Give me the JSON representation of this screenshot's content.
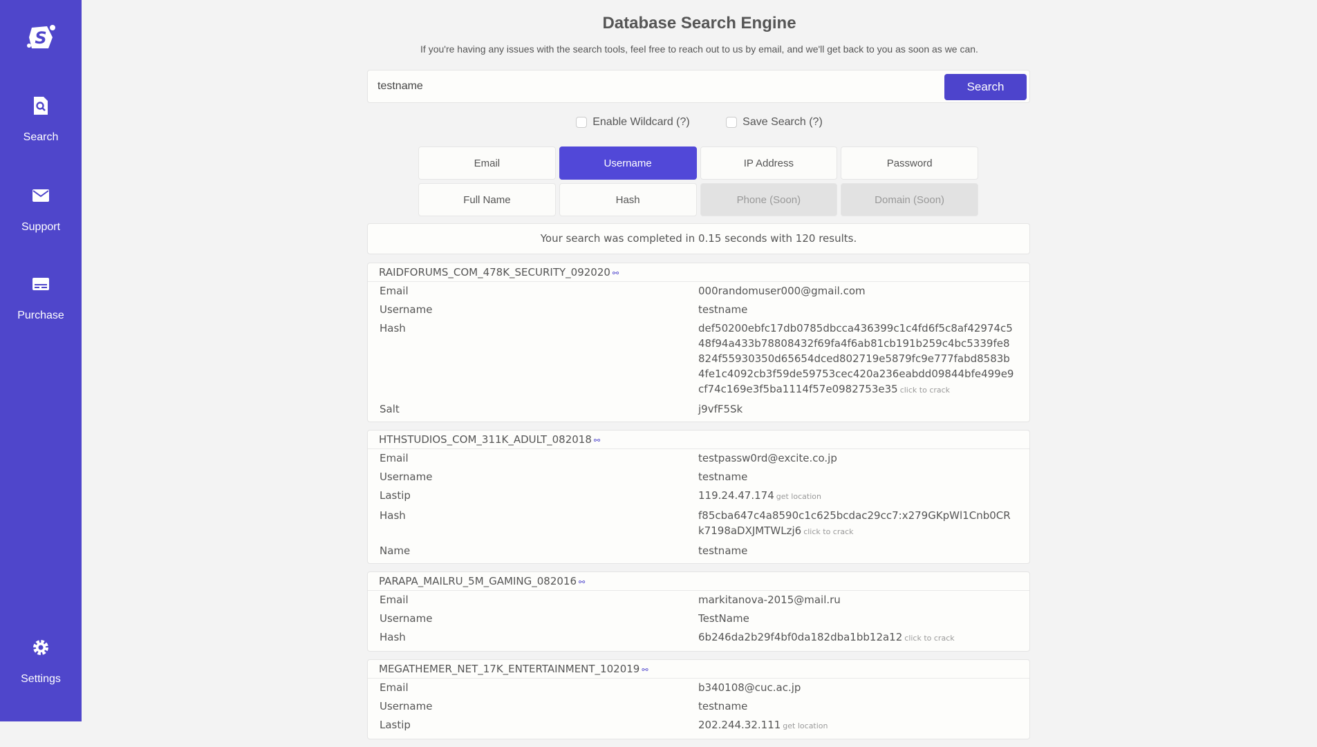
{
  "sidebar": {
    "items": [
      {
        "label": "Search",
        "icon": "search-file-icon"
      },
      {
        "label": "Support",
        "icon": "mail-icon"
      },
      {
        "label": "Purchase",
        "icon": "card-icon"
      },
      {
        "label": "Settings",
        "icon": "gear-icon"
      }
    ]
  },
  "header": {
    "title": "Database Search Engine",
    "subtitle": "If you're having any issues with the search tools, feel free to reach out to us by email, and we'll get back to you as soon as we can."
  },
  "search": {
    "value": "testname",
    "button": "Search"
  },
  "options": {
    "wildcard": "Enable Wildcard (?)",
    "save": "Save Search (?)"
  },
  "types": [
    {
      "label": "Email"
    },
    {
      "label": "Username",
      "active": true
    },
    {
      "label": "IP Address"
    },
    {
      "label": "Password"
    },
    {
      "label": "Full Name"
    },
    {
      "label": "Hash"
    },
    {
      "label": "Phone (Soon)",
      "disabled": true
    },
    {
      "label": "Domain (Soon)",
      "disabled": true
    }
  ],
  "status": "Your search was completed in 0.15 seconds with 120 results.",
  "hints": {
    "crack": "click to crack",
    "location": "get location"
  },
  "results": [
    {
      "source": "RAIDFORUMS_COM_478K_SECURITY_092020",
      "fields": [
        [
          "Email",
          "000randomuser000@gmail.com"
        ],
        [
          "Username",
          "testname"
        ],
        [
          "Hash",
          "def50200ebfc17db0785dbcca436399c1c4fd6f5c8af42974c548f94a433b78808432f69fa4f6ab81cb191b259c4bc5339fe8824f55930350d65654dced802719e5879fc9e777fabd8583b4fe1c4092cb3f59de59753cec420a236eabdd09844bfe499e9cf74c169e3f5ba1114f57e0982753e35"
        ],
        [
          "Salt",
          "j9vfF5Sk"
        ]
      ]
    },
    {
      "source": "HTHSTUDIOS_COM_311K_ADULT_082018",
      "fields": [
        [
          "Email",
          "testpassw0rd@excite.co.jp"
        ],
        [
          "Username",
          "testname"
        ],
        [
          "Lastip",
          "119.24.47.174"
        ],
        [
          "Hash",
          "f85cba647c4a8590c1c625bcdac29cc7:x279GKpWl1Cnb0CRk7198aDXJMTWLzj6"
        ],
        [
          "Name",
          "testname"
        ]
      ]
    },
    {
      "source": "PARAPA_MAILRU_5M_GAMING_082016",
      "fields": [
        [
          "Email",
          "markitanova-2015@mail.ru"
        ],
        [
          "Username",
          "TestName"
        ],
        [
          "Hash",
          "6b246da2b29f4bf0da182dba1bb12a12"
        ]
      ]
    },
    {
      "source": "MEGATHEMER_NET_17K_ENTERTAINMENT_102019",
      "fields": [
        [
          "Email",
          "b340108@cuc.ac.jp"
        ],
        [
          "Username",
          "testname"
        ],
        [
          "Lastip",
          "202.244.32.111"
        ]
      ]
    }
  ]
}
